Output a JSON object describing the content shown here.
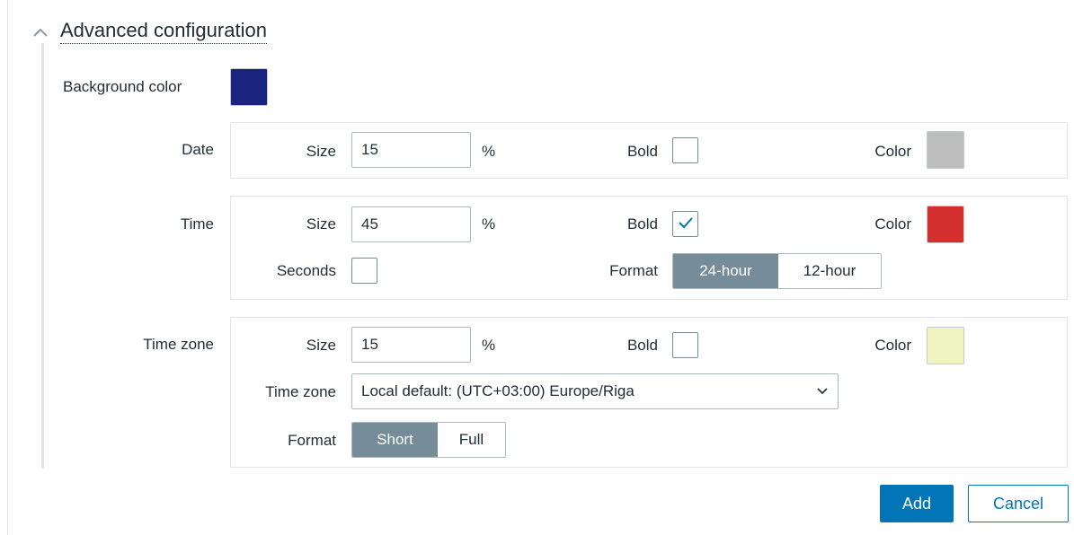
{
  "advanced": {
    "title": "Advanced configuration",
    "background_color_label": "Background color",
    "background_color": "#1a237e"
  },
  "date": {
    "label": "Date",
    "size_label": "Size",
    "size_value": "15",
    "unit": "%",
    "bold_label": "Bold",
    "bold_checked": false,
    "color_label": "Color",
    "color": "#bdbdbd"
  },
  "time": {
    "label": "Time",
    "size_label": "Size",
    "size_value": "45",
    "unit": "%",
    "bold_label": "Bold",
    "bold_checked": true,
    "color_label": "Color",
    "color": "#d32f2f",
    "seconds_label": "Seconds",
    "seconds_checked": false,
    "format_label": "Format",
    "format_options": [
      "24-hour",
      "12-hour"
    ],
    "format_selected": "24-hour"
  },
  "timezone": {
    "label": "Time zone",
    "size_label": "Size",
    "size_value": "15",
    "unit": "%",
    "bold_label": "Bold",
    "bold_checked": false,
    "color_label": "Color",
    "color": "#f0f4c3",
    "tz_label": "Time zone",
    "tz_value": "Local default: (UTC+03:00) Europe/Riga",
    "format_label": "Format",
    "format_options": [
      "Short",
      "Full"
    ],
    "format_selected": "Short"
  },
  "buttons": {
    "add": "Add",
    "cancel": "Cancel"
  },
  "icons": {
    "collapse": "chevron-up-icon",
    "dropdown": "chevron-down-icon",
    "check": "check-icon"
  },
  "colors": {
    "accent": "#0275b8",
    "segment_active": "#768d99"
  }
}
